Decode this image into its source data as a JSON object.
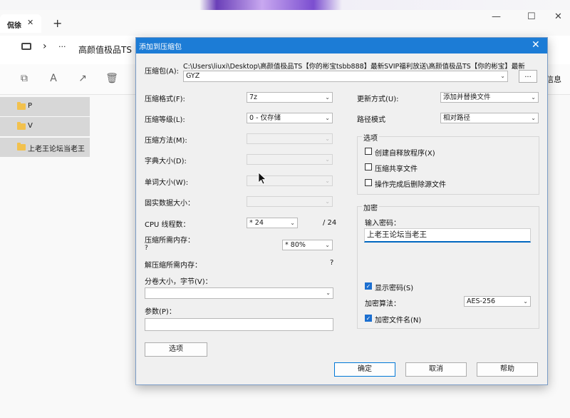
{
  "explorer": {
    "tab_label": "侃徐",
    "tab_close": "✕",
    "tab_add": "+",
    "win_min": "—",
    "win_max": "☐",
    "win_close": "✕",
    "nav_chevron": "›",
    "nav_more": "···",
    "address_text": "高颜值极品TS",
    "info_label": "信息",
    "files": [
      "P",
      "V",
      "上老王论坛当老王"
    ]
  },
  "dialog": {
    "title": "添加到压缩包",
    "archive_label": "压缩包(A):",
    "archive_path": "C:\\Users\\liuxi\\Desktop\\高颜值极品TS【你的彬宝tsbb888】最新SVIP福利放送\\高颜值极品TS【你的彬宝】最新",
    "archive_name": "GYZ",
    "browse_label": "...",
    "format_label": "压缩格式(F):",
    "format_value": "7z",
    "level_label": "压缩等级(L):",
    "level_value": "0 - 仅存储",
    "method_label": "压缩方法(M):",
    "dict_label": "字典大小(D):",
    "word_label": "单词大小(W):",
    "solid_label": "固实数据大小：",
    "cpu_label": "CPU 线程数：",
    "cpu_value": "* 24",
    "cpu_max": "/ 24",
    "mem_label": "压缩所需内存：",
    "mem_q": "?",
    "mem_value": "* 80%",
    "decomp_label": "解压缩所需内存：",
    "decomp_q": "?",
    "split_label": "分卷大小，字节(V)：",
    "params_label": "参数(P)：",
    "options_button": "选项",
    "update_label": "更新方式(U):",
    "update_value": "添加并替换文件",
    "path_label": "路径模式",
    "path_value": "相对路径",
    "options_group": "选项",
    "opt_sfx": "创建自释放程序(X)",
    "opt_shared": "压缩共享文件",
    "opt_delete": "操作完成后删除源文件",
    "encrypt_group": "加密",
    "password_label": "输入密码：",
    "password_value": "上老王论坛当老王",
    "show_password": "显示密码(S)",
    "enc_method_label": "加密算法：",
    "enc_method_value": "AES-256",
    "enc_names": "加密文件名(N)",
    "ok": "确定",
    "cancel": "取消",
    "help": "帮助",
    "dropdown_glyph": "⌄",
    "check_glyph": "✓"
  }
}
